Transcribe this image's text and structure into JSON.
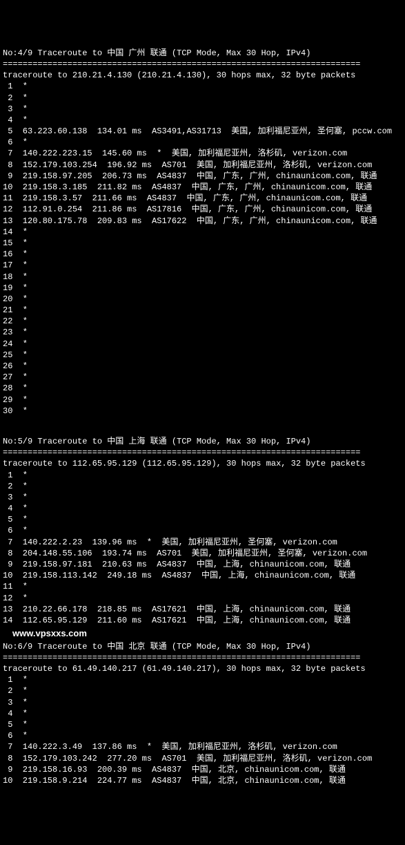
{
  "separator": "========================================================================",
  "watermark": "www.vpsxxs.com",
  "sections": [
    {
      "title": "No:4/9 Traceroute to 中国 广州 联通 (TCP Mode, Max 30 Hop, IPv4)",
      "trace_header": "traceroute to 210.21.4.130 (210.21.4.130), 30 hops max, 32 byte packets",
      "hops": [
        {
          "n": 1,
          "txt": "*"
        },
        {
          "n": 2,
          "txt": "*"
        },
        {
          "n": 3,
          "txt": "*"
        },
        {
          "n": 4,
          "txt": "*"
        },
        {
          "n": 5,
          "txt": "63.223.60.138  134.01 ms  AS3491,AS31713  美国, 加利福尼亚州, 圣何塞, pccw.com"
        },
        {
          "n": 6,
          "txt": "*"
        },
        {
          "n": 7,
          "txt": "140.222.223.15  145.60 ms  *  美国, 加利福尼亚州, 洛杉矶, verizon.com"
        },
        {
          "n": 8,
          "txt": "152.179.103.254  196.92 ms  AS701  美国, 加利福尼亚州, 洛杉矶, verizon.com"
        },
        {
          "n": 9,
          "txt": "219.158.97.205  206.73 ms  AS4837  中国, 广东, 广州, chinaunicom.com, 联通"
        },
        {
          "n": 10,
          "txt": "219.158.3.185  211.82 ms  AS4837  中国, 广东, 广州, chinaunicom.com, 联通"
        },
        {
          "n": 11,
          "txt": "219.158.3.57  211.66 ms  AS4837  中国, 广东, 广州, chinaunicom.com, 联通"
        },
        {
          "n": 12,
          "txt": "112.91.0.254  211.86 ms  AS17816  中国, 广东, 广州, chinaunicom.com, 联通"
        },
        {
          "n": 13,
          "txt": "120.80.175.78  209.83 ms  AS17622  中国, 广东, 广州, chinaunicom.com, 联通"
        },
        {
          "n": 14,
          "txt": "*"
        },
        {
          "n": 15,
          "txt": "*"
        },
        {
          "n": 16,
          "txt": "*"
        },
        {
          "n": 17,
          "txt": "*"
        },
        {
          "n": 18,
          "txt": "*"
        },
        {
          "n": 19,
          "txt": "*"
        },
        {
          "n": 20,
          "txt": "*"
        },
        {
          "n": 21,
          "txt": "*"
        },
        {
          "n": 22,
          "txt": "*"
        },
        {
          "n": 23,
          "txt": "*"
        },
        {
          "n": 24,
          "txt": "*"
        },
        {
          "n": 25,
          "txt": "*"
        },
        {
          "n": 26,
          "txt": "*"
        },
        {
          "n": 27,
          "txt": "*"
        },
        {
          "n": 28,
          "txt": "*"
        },
        {
          "n": 29,
          "txt": "*"
        },
        {
          "n": 30,
          "txt": "*"
        }
      ]
    },
    {
      "title": "No:5/9 Traceroute to 中国 上海 联通 (TCP Mode, Max 30 Hop, IPv4)",
      "trace_header": "traceroute to 112.65.95.129 (112.65.95.129), 30 hops max, 32 byte packets",
      "hops": [
        {
          "n": 1,
          "txt": "*"
        },
        {
          "n": 2,
          "txt": "*"
        },
        {
          "n": 3,
          "txt": "*"
        },
        {
          "n": 4,
          "txt": "*"
        },
        {
          "n": 5,
          "txt": "*"
        },
        {
          "n": 6,
          "txt": "*"
        },
        {
          "n": 7,
          "txt": "140.222.2.23  139.96 ms  *  美国, 加利福尼亚州, 圣何塞, verizon.com"
        },
        {
          "n": 8,
          "txt": "204.148.55.106  193.74 ms  AS701  美国, 加利福尼亚州, 圣何塞, verizon.com"
        },
        {
          "n": 9,
          "txt": "219.158.97.181  210.63 ms  AS4837  中国, 上海, chinaunicom.com, 联通"
        },
        {
          "n": 10,
          "txt": "219.158.113.142  249.18 ms  AS4837  中国, 上海, chinaunicom.com, 联通"
        },
        {
          "n": 11,
          "txt": "*"
        },
        {
          "n": 12,
          "txt": "*"
        },
        {
          "n": 13,
          "txt": "210.22.66.178  218.85 ms  AS17621  中国, 上海, chinaunicom.com, 联通"
        },
        {
          "n": 14,
          "txt": "112.65.95.129  211.60 ms  AS17621  中国, 上海, chinaunicom.com, 联通"
        }
      ]
    },
    {
      "title": "No:6/9 Traceroute to 中国 北京 联通 (TCP Mode, Max 30 Hop, IPv4)",
      "trace_header": "traceroute to 61.49.140.217 (61.49.140.217), 30 hops max, 32 byte packets",
      "hops": [
        {
          "n": 1,
          "txt": "*"
        },
        {
          "n": 2,
          "txt": "*"
        },
        {
          "n": 3,
          "txt": "*"
        },
        {
          "n": 4,
          "txt": "*"
        },
        {
          "n": 5,
          "txt": "*"
        },
        {
          "n": 6,
          "txt": "*"
        },
        {
          "n": 7,
          "txt": "140.222.3.49  137.86 ms  *  美国, 加利福尼亚州, 洛杉矶, verizon.com"
        },
        {
          "n": 8,
          "txt": "152.179.103.242  277.20 ms  AS701  美国, 加利福尼亚州, 洛杉矶, verizon.com"
        },
        {
          "n": 9,
          "txt": "219.158.16.93  200.39 ms  AS4837  中国, 北京, chinaunicom.com, 联通"
        },
        {
          "n": 10,
          "txt": "219.158.9.214  224.77 ms  AS4837  中国, 北京, chinaunicom.com, 联通"
        }
      ]
    }
  ]
}
